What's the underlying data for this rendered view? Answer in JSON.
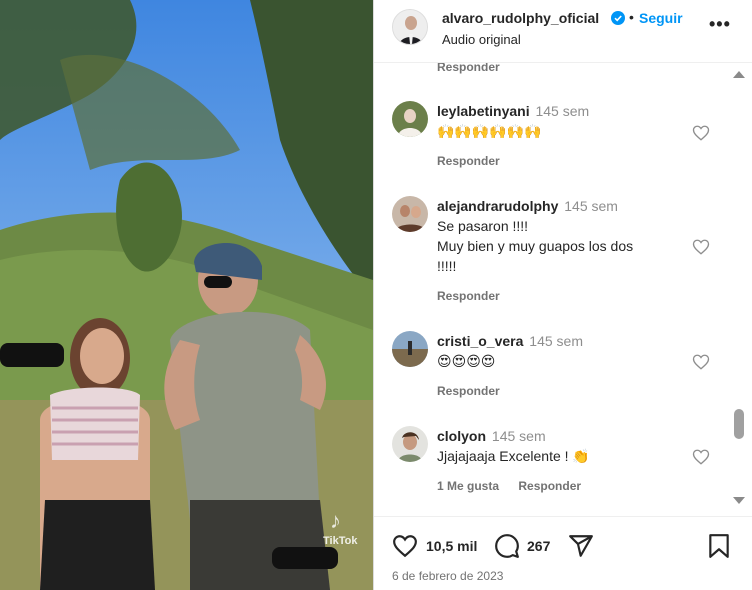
{
  "header": {
    "username": "alvaro_rudolphy_oficial",
    "separator": "•",
    "follow_label": "Seguir",
    "audio_label": "Audio original",
    "more_label": "•••"
  },
  "comments": {
    "top_reply_label": "Responder",
    "items": [
      {
        "user": "leylabetinyani",
        "time": "145 sem",
        "text": "🙌🙌🙌🙌🙌🙌",
        "reply_label": "Responder"
      },
      {
        "user": "alejandrarudolphy",
        "time": "145 sem",
        "text": "Se pasaron !!!!",
        "text2": "Muy bien y muy guapos los dos",
        "text3": "!!!!!",
        "reply_label": "Responder"
      },
      {
        "user": "cristi_o_vera",
        "time": "145 sem",
        "text": "😍😍😍😍",
        "reply_label": "Responder"
      },
      {
        "user": "clolyon",
        "time": "145 sem",
        "text": "Jjajajaaja Excelente ! 👏",
        "likes_label": "1 Me gusta",
        "reply_label": "Responder"
      }
    ]
  },
  "actions": {
    "likes": "10,5 mil",
    "comments": "267",
    "date": "6 de febrero de 2023"
  },
  "video": {
    "watermark": "TikTok"
  },
  "colors": {
    "accent": "#0095f6",
    "muted": "#737373",
    "time": "#8e8e8e"
  }
}
